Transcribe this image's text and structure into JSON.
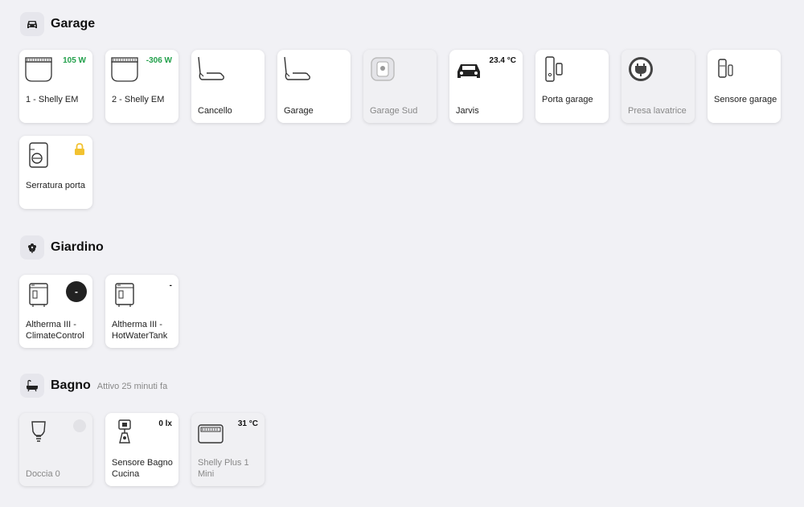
{
  "sections": {
    "garage": {
      "title": "Garage"
    },
    "giardino": {
      "title": "Giardino"
    },
    "bagno": {
      "title": "Bagno",
      "subtitle": "Attivo 25 minuti fa"
    }
  },
  "garage_cards": [
    {
      "label": "1 - Shelly EM",
      "value": "105 W"
    },
    {
      "label": "2 - Shelly EM",
      "value": "-306 W"
    },
    {
      "label": "Cancello"
    },
    {
      "label": "Garage"
    },
    {
      "label": "Garage Sud"
    },
    {
      "label": "Jarvis",
      "value": "23.4 °C"
    },
    {
      "label": "Porta garage"
    },
    {
      "label": "Presa lavatrice"
    },
    {
      "label": "Sensore garage"
    },
    {
      "label": "Serratura porta"
    }
  ],
  "giardino_cards": [
    {
      "label": "Altherma III - ClimateControl",
      "value": "-"
    },
    {
      "label": "Altherma III - HotWaterTank",
      "value": "-"
    }
  ],
  "bagno_cards": [
    {
      "label": "Doccia 0"
    },
    {
      "label": "Sensore Bagno Cucina",
      "value": "0 lx"
    },
    {
      "label": "Shelly Plus 1 Mini",
      "value": "31 °C"
    }
  ],
  "colors": {
    "positive": "#22a04b",
    "lock": "#f2c230",
    "background": "#f1f1f5"
  },
  "icons": {
    "garage": "car-icon",
    "giardino": "flower-icon",
    "bagno": "bathtub-icon"
  }
}
